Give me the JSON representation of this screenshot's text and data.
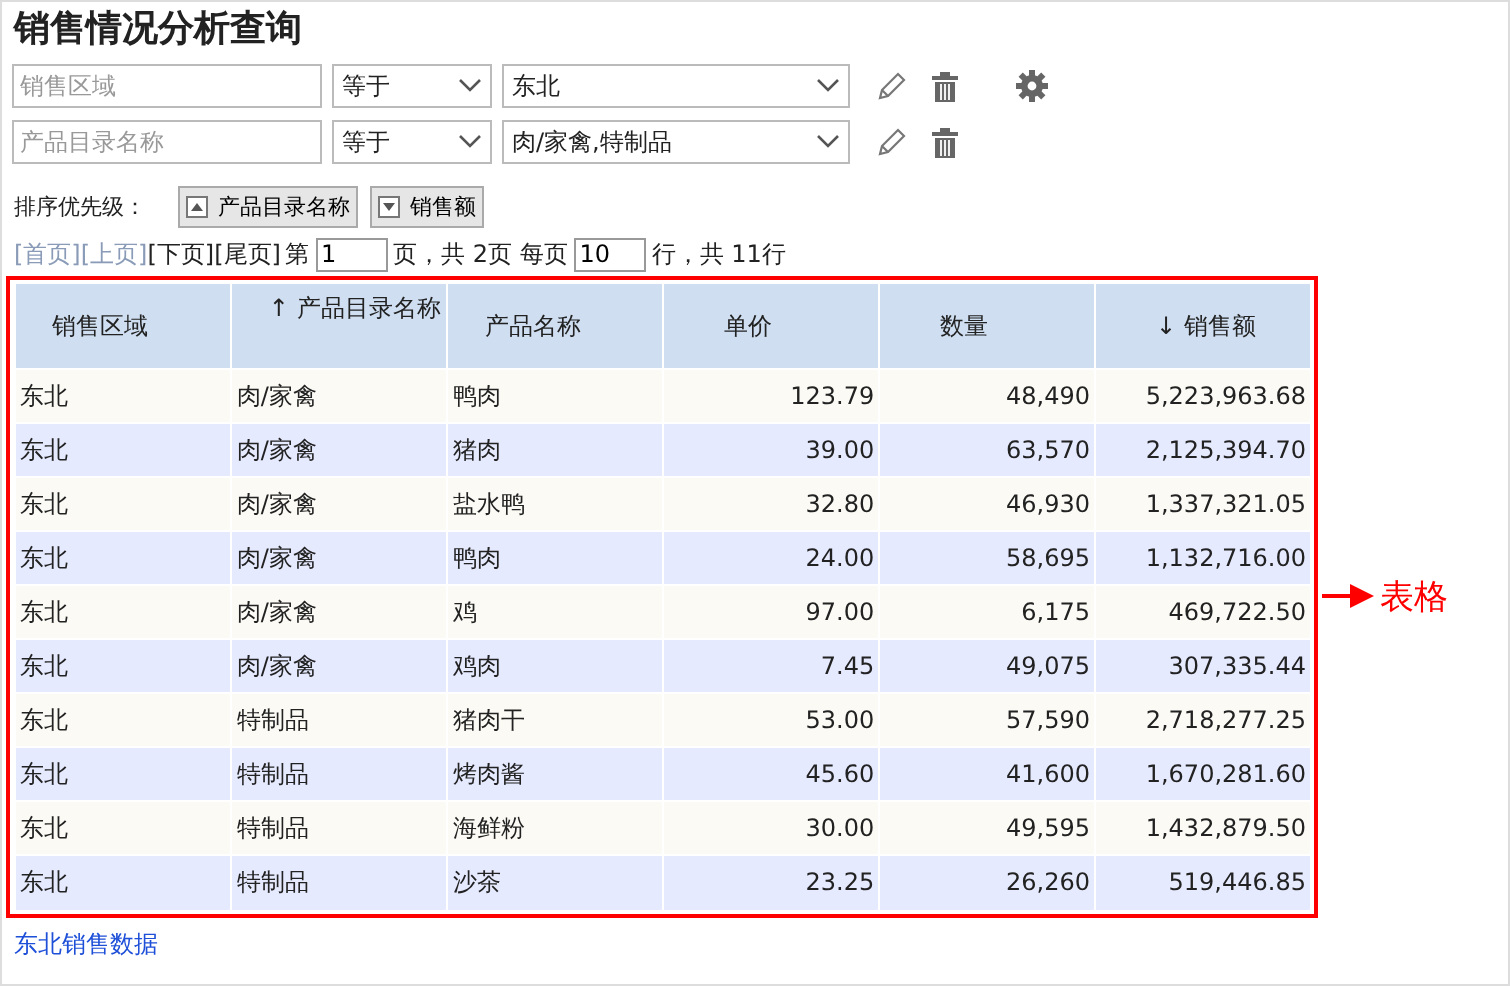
{
  "title": "销售情况分析查询",
  "filters": [
    {
      "placeholder": "销售区域",
      "operator": "等于",
      "value": "东北",
      "settings": true
    },
    {
      "placeholder": "产品目录名称",
      "operator": "等于",
      "value": "肉/家禽,特制品",
      "settings": false
    }
  ],
  "sort_priority": {
    "label": "排序优先级：",
    "items": [
      {
        "label": "产品目录名称",
        "ascending": true
      },
      {
        "label": "销售额",
        "ascending": false
      }
    ]
  },
  "pagination": {
    "links": [
      {
        "label": "[首页]",
        "disabled": true
      },
      {
        "label": "[上页]",
        "disabled": true
      },
      {
        "label": "[下页]",
        "disabled": false
      },
      {
        "label": "[尾页]",
        "disabled": false
      }
    ],
    "page_prefix": "第",
    "page": "1",
    "page_text": "页，共 2页 每页",
    "rows_per_page": "10",
    "rows_text": "行，共 11行"
  },
  "table": {
    "columns": [
      {
        "label": "销售区域",
        "numeric": false
      },
      {
        "label": "产品目录名称",
        "sort_arrow": "↑",
        "numeric": false
      },
      {
        "label": "产品名称",
        "numeric": false
      },
      {
        "label": "单价",
        "numeric": true
      },
      {
        "label": "数量",
        "numeric": true
      },
      {
        "label": "销售额",
        "sort_arrow": "↓",
        "numeric": true
      }
    ],
    "rows": [
      [
        "东北",
        "肉/家禽",
        "鸭肉",
        "123.79",
        "48,490",
        "5,223,963.68"
      ],
      [
        "东北",
        "肉/家禽",
        "猪肉",
        "39.00",
        "63,570",
        "2,125,394.70"
      ],
      [
        "东北",
        "肉/家禽",
        "盐水鸭",
        "32.80",
        "46,930",
        "1,337,321.05"
      ],
      [
        "东北",
        "肉/家禽",
        "鸭肉",
        "24.00",
        "58,695",
        "1,132,716.00"
      ],
      [
        "东北",
        "肉/家禽",
        "鸡",
        "97.00",
        "6,175",
        "469,722.50"
      ],
      [
        "东北",
        "肉/家禽",
        "鸡肉",
        "7.45",
        "49,075",
        "307,335.44"
      ],
      [
        "东北",
        "特制品",
        "猪肉干",
        "53.00",
        "57,590",
        "2,718,277.25"
      ],
      [
        "东北",
        "特制品",
        "烤肉酱",
        "45.60",
        "41,600",
        "1,670,281.60"
      ],
      [
        "东北",
        "特制品",
        "海鲜粉",
        "30.00",
        "49,595",
        "1,432,879.50"
      ],
      [
        "东北",
        "特制品",
        "沙茶",
        "23.25",
        "26,260",
        "519,446.85"
      ]
    ]
  },
  "annotation": "表格",
  "footer_link": "东北销售数据"
}
